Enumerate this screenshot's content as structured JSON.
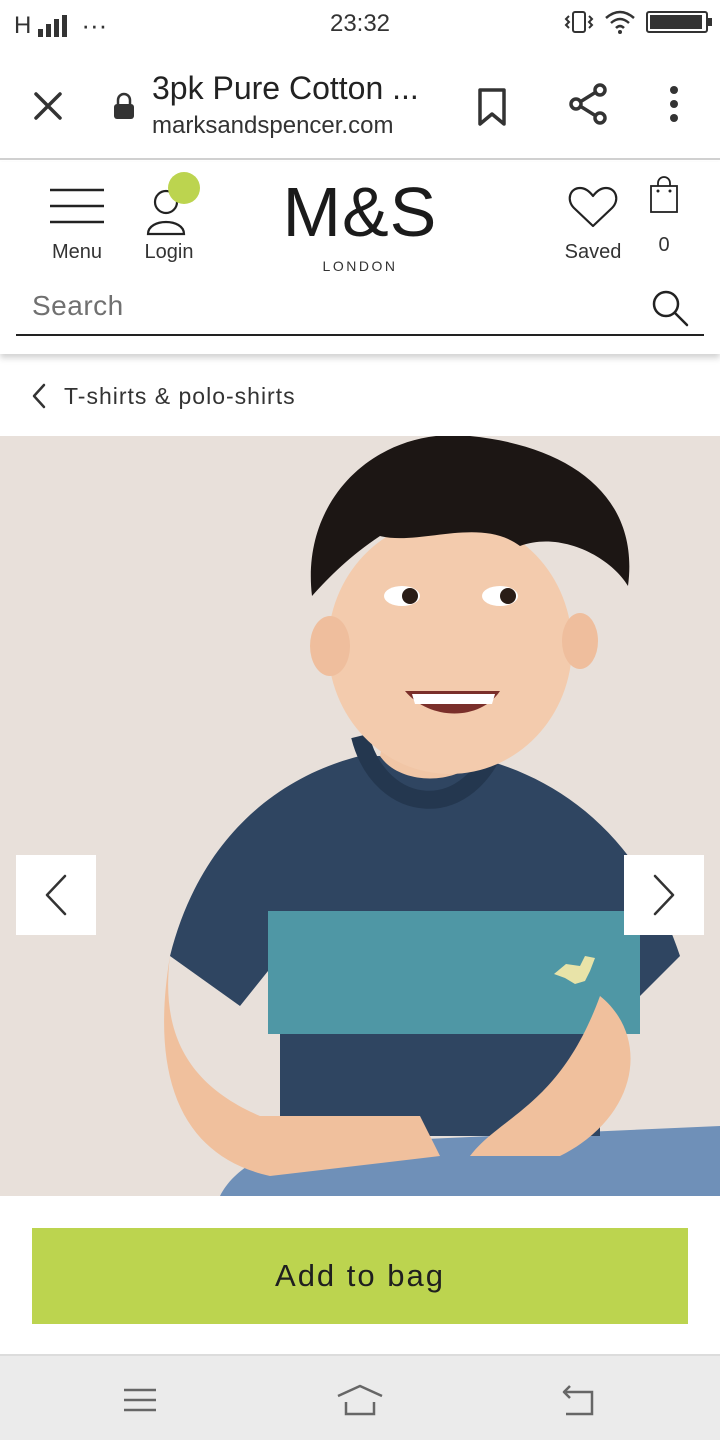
{
  "status_bar": {
    "carrier": "H",
    "dots": "···",
    "time": "23:32",
    "battery_level": 0.9
  },
  "browser": {
    "title": "3pk Pure Cotton ...",
    "domain": "marksandspencer.com"
  },
  "header": {
    "menu_label": "Menu",
    "login_label": "Login",
    "logo_text": "M&S",
    "logo_subtext": "LONDON",
    "saved_label": "Saved",
    "bag_count": "0",
    "search_placeholder": "Search",
    "login_badge_color": "#bcd44f"
  },
  "breadcrumb": {
    "label": "T-shirts & polo-shirts"
  },
  "product": {
    "add_to_bag_label": "Add to bag",
    "accent_color": "#bcd44f"
  },
  "icons": {
    "close": "close-icon",
    "lock": "lock-icon",
    "bookmark": "bookmark-icon",
    "share": "share-icon",
    "more": "more-vertical-icon",
    "menu": "hamburger-icon",
    "user": "user-icon",
    "heart": "heart-icon",
    "bag": "shopping-bag-icon",
    "search": "search-icon",
    "back": "chevron-left-icon",
    "prev": "chevron-left-icon",
    "next": "chevron-right-icon"
  }
}
